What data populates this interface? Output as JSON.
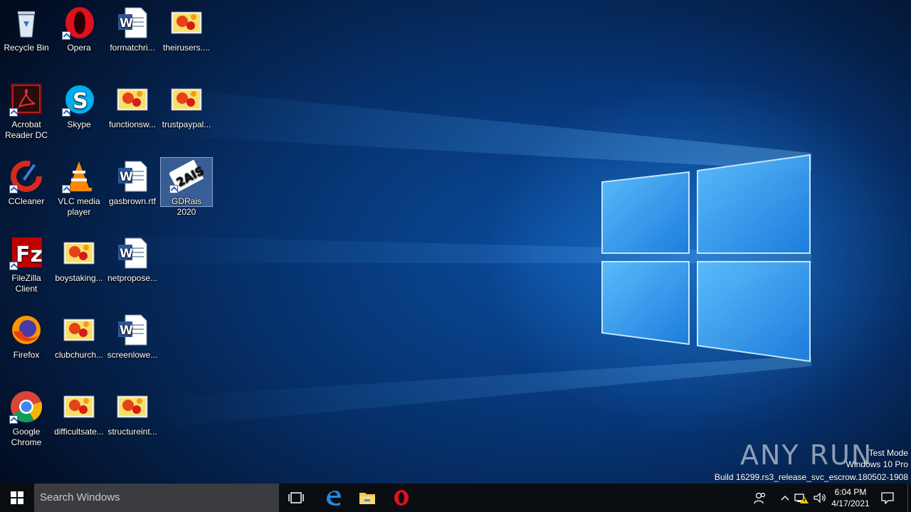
{
  "desktop_icons": [
    {
      "label": "Recycle Bin",
      "icon": "recycle-bin-icon"
    },
    {
      "label": "Opera",
      "icon": "opera-icon"
    },
    {
      "label": "formatchri...",
      "icon": "word-doc-icon"
    },
    {
      "label": "theirusers....",
      "icon": "image-file-icon"
    },
    {
      "label": "Acrobat Reader DC",
      "icon": "acrobat-icon"
    },
    {
      "label": "Skype",
      "icon": "skype-icon"
    },
    {
      "label": "functionsw...",
      "icon": "image-file-icon"
    },
    {
      "label": "trustpaypal...",
      "icon": "image-file-icon"
    },
    {
      "label": "CCleaner",
      "icon": "ccleaner-icon"
    },
    {
      "label": "VLC media player",
      "icon": "vlc-icon"
    },
    {
      "label": "gasbrown.rtf",
      "icon": "word-doc-icon"
    },
    {
      "label": "GDRais 2020",
      "icon": "gdrais-icon"
    },
    {
      "label": "FileZilla Client",
      "icon": "filezilla-icon"
    },
    {
      "label": "boystaking...",
      "icon": "image-file-icon"
    },
    {
      "label": "netpropose...",
      "icon": "word-doc-icon"
    },
    {
      "label": "Firefox",
      "icon": "firefox-icon"
    },
    {
      "label": "clubchurch...",
      "icon": "image-file-icon"
    },
    {
      "label": "screenlowe...",
      "icon": "word-doc-icon"
    },
    {
      "label": "Google Chrome",
      "icon": "chrome-icon"
    },
    {
      "label": "difficultsate...",
      "icon": "image-file-icon"
    },
    {
      "label": "structureint...",
      "icon": "image-file-icon"
    }
  ],
  "watermark": {
    "brand": "ANY RUN",
    "line1": "Test Mode",
    "line2": "Windows 10 Pro",
    "line3": "Build 16299.rs3_release_svc_escrow.180502-1908"
  },
  "taskbar": {
    "search_placeholder": "Search Windows",
    "pinned": [
      "task-view-icon",
      "edge-icon",
      "file-explorer-icon",
      "opera-icon"
    ],
    "tray_time": "6:04 PM",
    "tray_date": "4/17/2021"
  },
  "colors": {
    "accent": "#0078d7",
    "taskbar": "#0a0d12",
    "search": "#3a3c40"
  }
}
